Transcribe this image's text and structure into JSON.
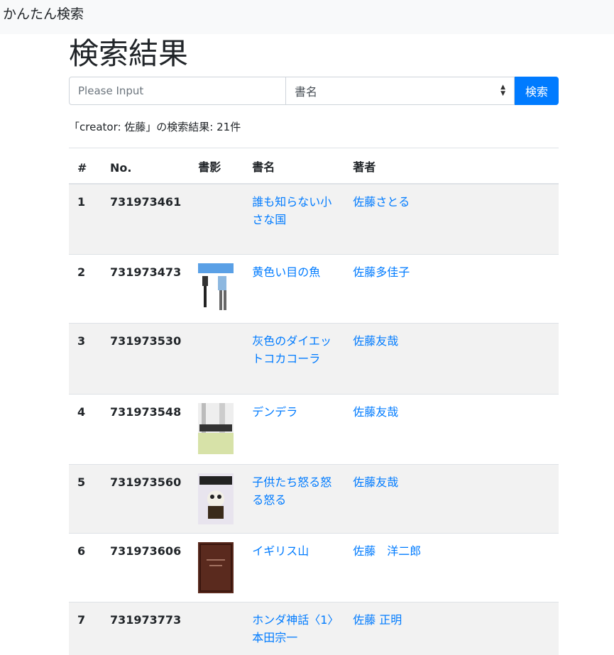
{
  "app": {
    "brand": "かんたん検索"
  },
  "page": {
    "title": "検索結果"
  },
  "search": {
    "placeholder": "Please Input",
    "field_selected": "書名",
    "button_label": "検索"
  },
  "summary": "「creator: 佐藤」の検索結果: 21件",
  "table": {
    "headers": [
      "#",
      "No.",
      "書影",
      "書名",
      "著者"
    ],
    "rows": [
      {
        "idx": "1",
        "no": "731973461",
        "cover": "",
        "title": "誰も知らない小さな国",
        "author": "佐藤さとる"
      },
      {
        "idx": "2",
        "no": "731973473",
        "cover": "cover-yellow-eyes",
        "title": "黄色い目の魚",
        "author": "佐藤多佳子"
      },
      {
        "idx": "3",
        "no": "731973530",
        "cover": "",
        "title": "灰色のダイエットコカコーラ",
        "author": "佐藤友哉"
      },
      {
        "idx": "4",
        "no": "731973548",
        "cover": "cover-dendera",
        "title": "デンデラ",
        "author": "佐藤友哉"
      },
      {
        "idx": "5",
        "no": "731973560",
        "cover": "cover-kodomo",
        "title": "子供たち怒る怒る怒る",
        "author": "佐藤友哉"
      },
      {
        "idx": "6",
        "no": "731973606",
        "cover": "cover-england",
        "title": "イギリス山",
        "author": "佐藤　洋二郎"
      },
      {
        "idx": "7",
        "no": "731973773",
        "cover": "",
        "title": "ホンダ神話〈1〉本田宗一",
        "author": "佐藤 正明"
      }
    ]
  }
}
